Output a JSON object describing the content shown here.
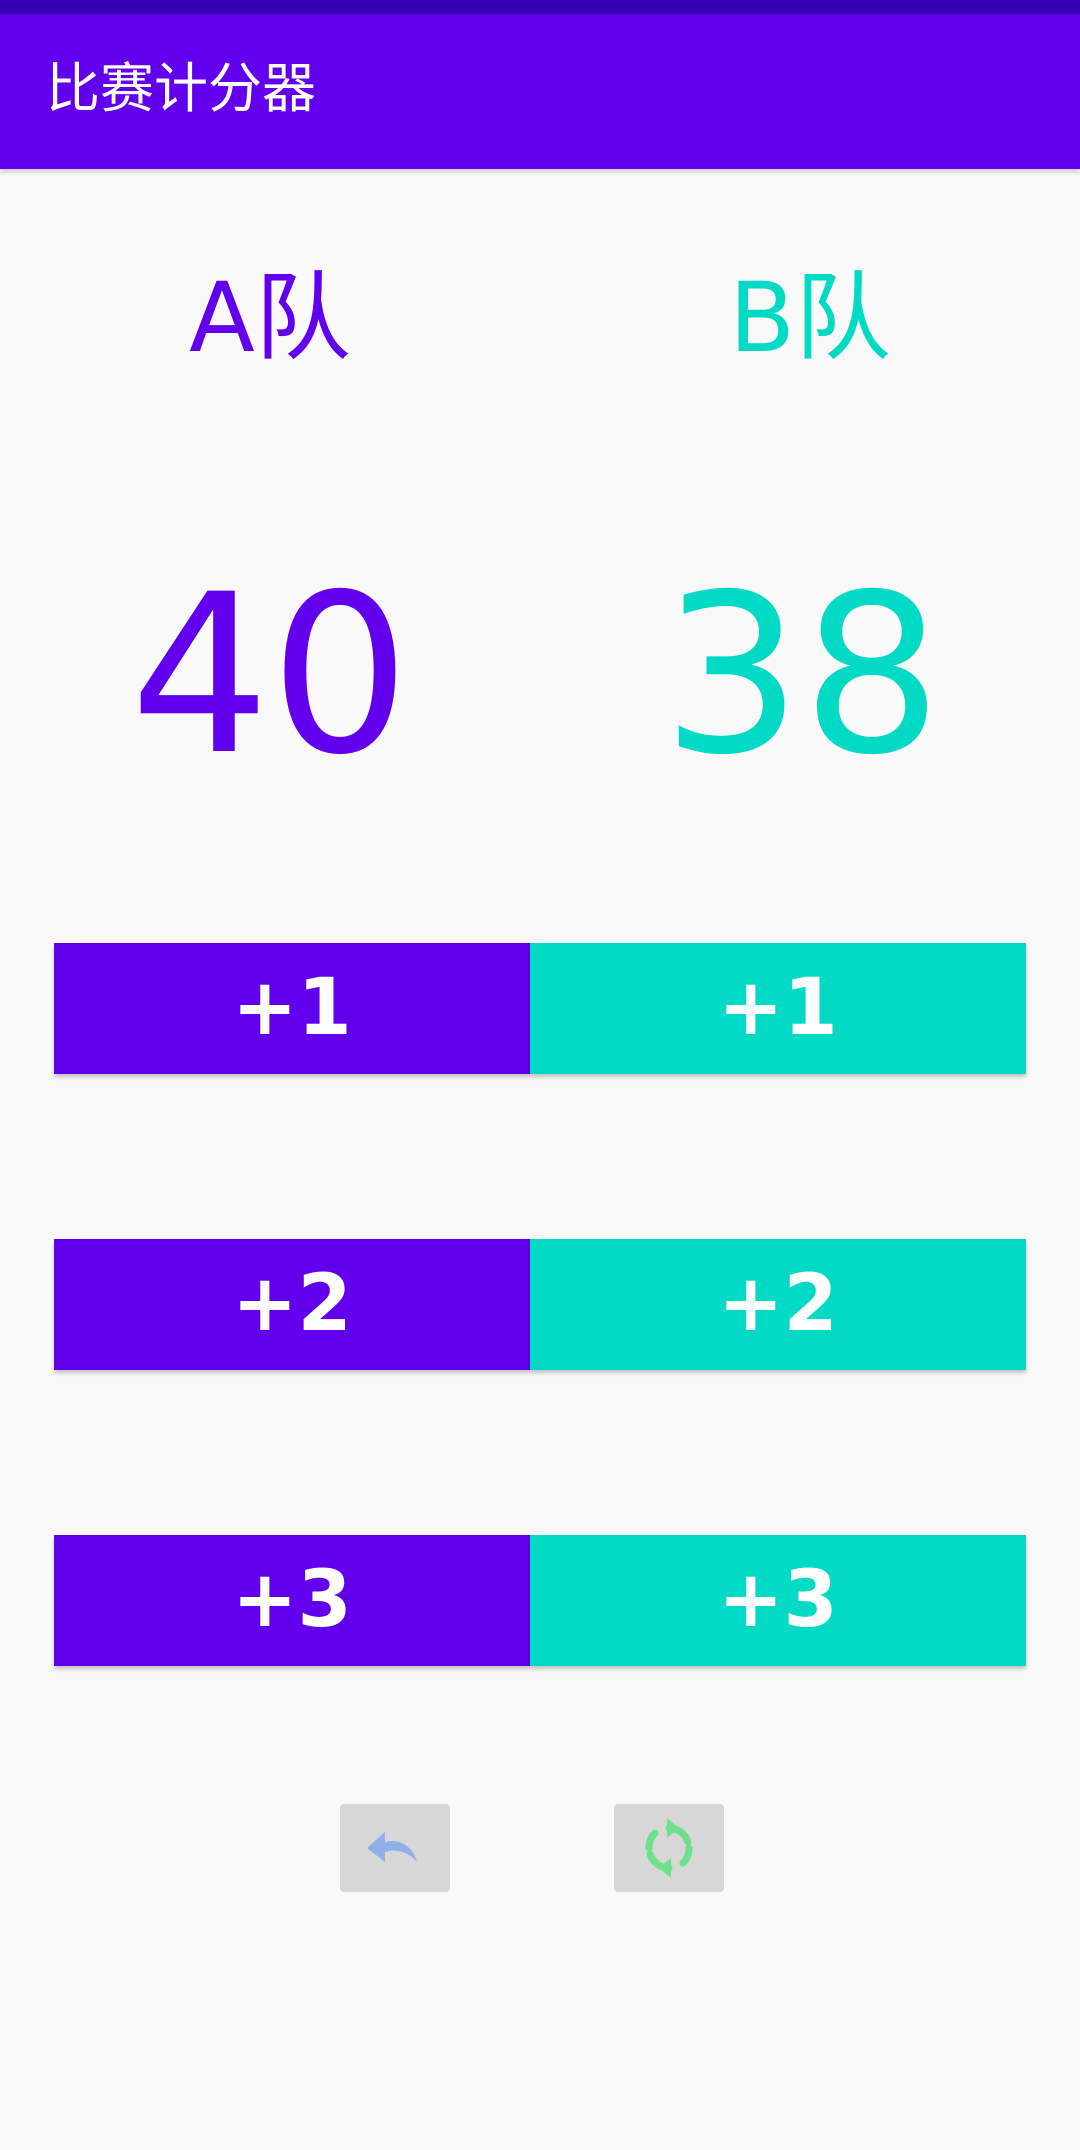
{
  "app": {
    "title": "比赛计分器"
  },
  "colors": {
    "primary": "#6200ee",
    "primary_dark": "#3700b3",
    "secondary": "#03dac5",
    "background": "#f9f9f9",
    "icon_button_bg": "#d7d7d7",
    "undo_icon": "#8fb0e8",
    "reset_icon": "#6ee08c"
  },
  "teams": {
    "a": {
      "label": "A队",
      "score": "40"
    },
    "b": {
      "label": "B队",
      "score": "38"
    }
  },
  "buttons": {
    "a": [
      "+1",
      "+2",
      "+3"
    ],
    "b": [
      "+1",
      "+2",
      "+3"
    ]
  },
  "actions": {
    "undo_icon": "undo-icon",
    "reset_icon": "refresh-icon"
  }
}
